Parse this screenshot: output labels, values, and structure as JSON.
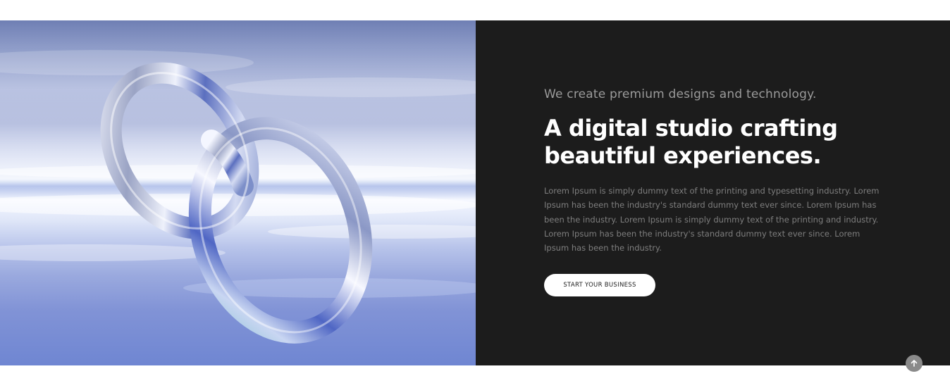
{
  "hero": {
    "image": {
      "alt_icon": "chrome-linked-rings-icon"
    },
    "eyebrow": "We create premium designs and technology.",
    "headline": "A digital studio crafting beautiful experiences.",
    "body": "Lorem Ipsum is simply dummy text of the printing and typesetting industry. Lorem Ipsum has been the industry's standard dummy text ever since. Lorem Ipsum has been the industry. Lorem Ipsum is simply dummy text of the printing and industry. Lorem Ipsum has been the industry's standard dummy text ever since. Lorem Ipsum has been the industry.",
    "cta_label": "START YOUR BUSINESS"
  },
  "scroll_top": {
    "icon": "arrow-up-icon"
  },
  "colors": {
    "panel_bg": "#1c1c1c",
    "headline": "#ffffff",
    "eyebrow": "#9b9b9b",
    "body": "#7e7e7e",
    "scroll_button": "#8a8a8a"
  }
}
